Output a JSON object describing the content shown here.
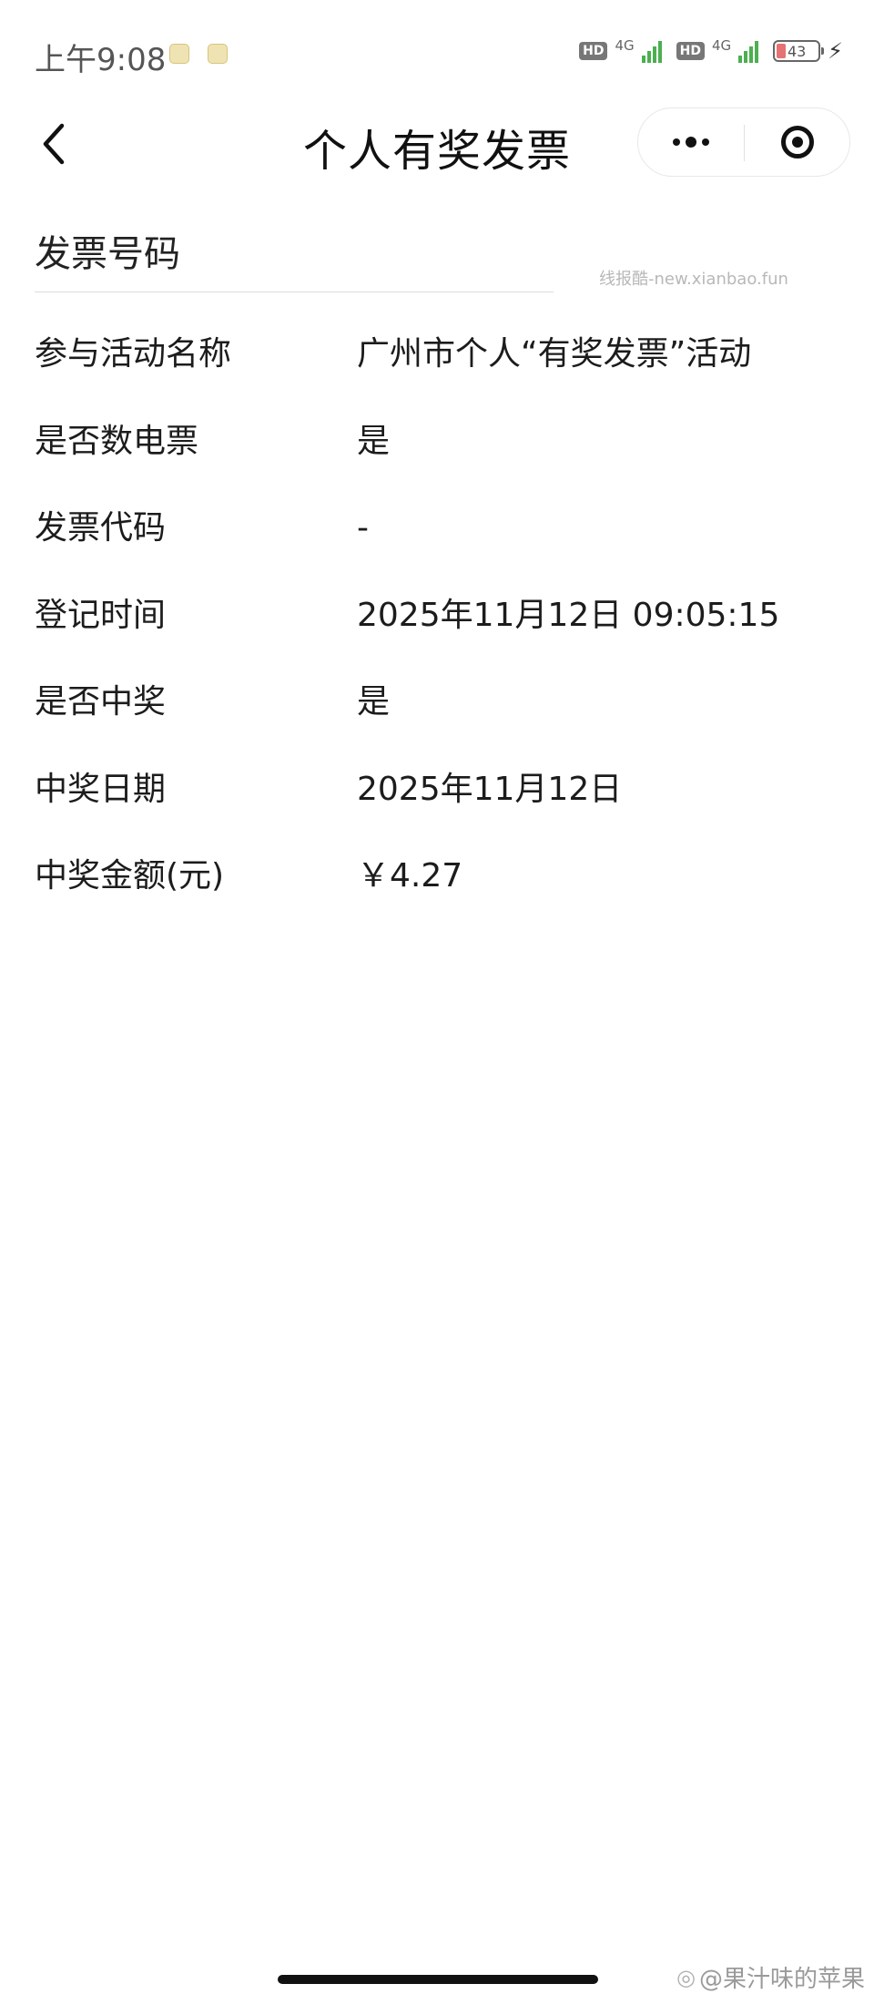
{
  "status_bar": {
    "time": "上午9:08",
    "hd_1": "HD",
    "net_1": "4G",
    "hd_2": "HD",
    "net_2": "4G",
    "battery": "43"
  },
  "nav": {
    "title": "个人有奖发票"
  },
  "invoice_number_label": "发票号码",
  "watermark": "线报酷-new.xianbao.fun",
  "details": [
    {
      "label": "参与活动名称",
      "value": "广州市个人“有奖发票”活动"
    },
    {
      "label": "是否数电票",
      "value": "是"
    },
    {
      "label": "发票代码",
      "value": "-"
    },
    {
      "label": "登记时间",
      "value": "2025年11月12日 09:05:15"
    },
    {
      "label": "是否中奖",
      "value": "是"
    },
    {
      "label": "中奖日期",
      "value": "2025年11月12日"
    },
    {
      "label": "中奖金额(元)",
      "value": "￥4.27"
    }
  ],
  "weibo_credit": "@果汁味的苹果"
}
